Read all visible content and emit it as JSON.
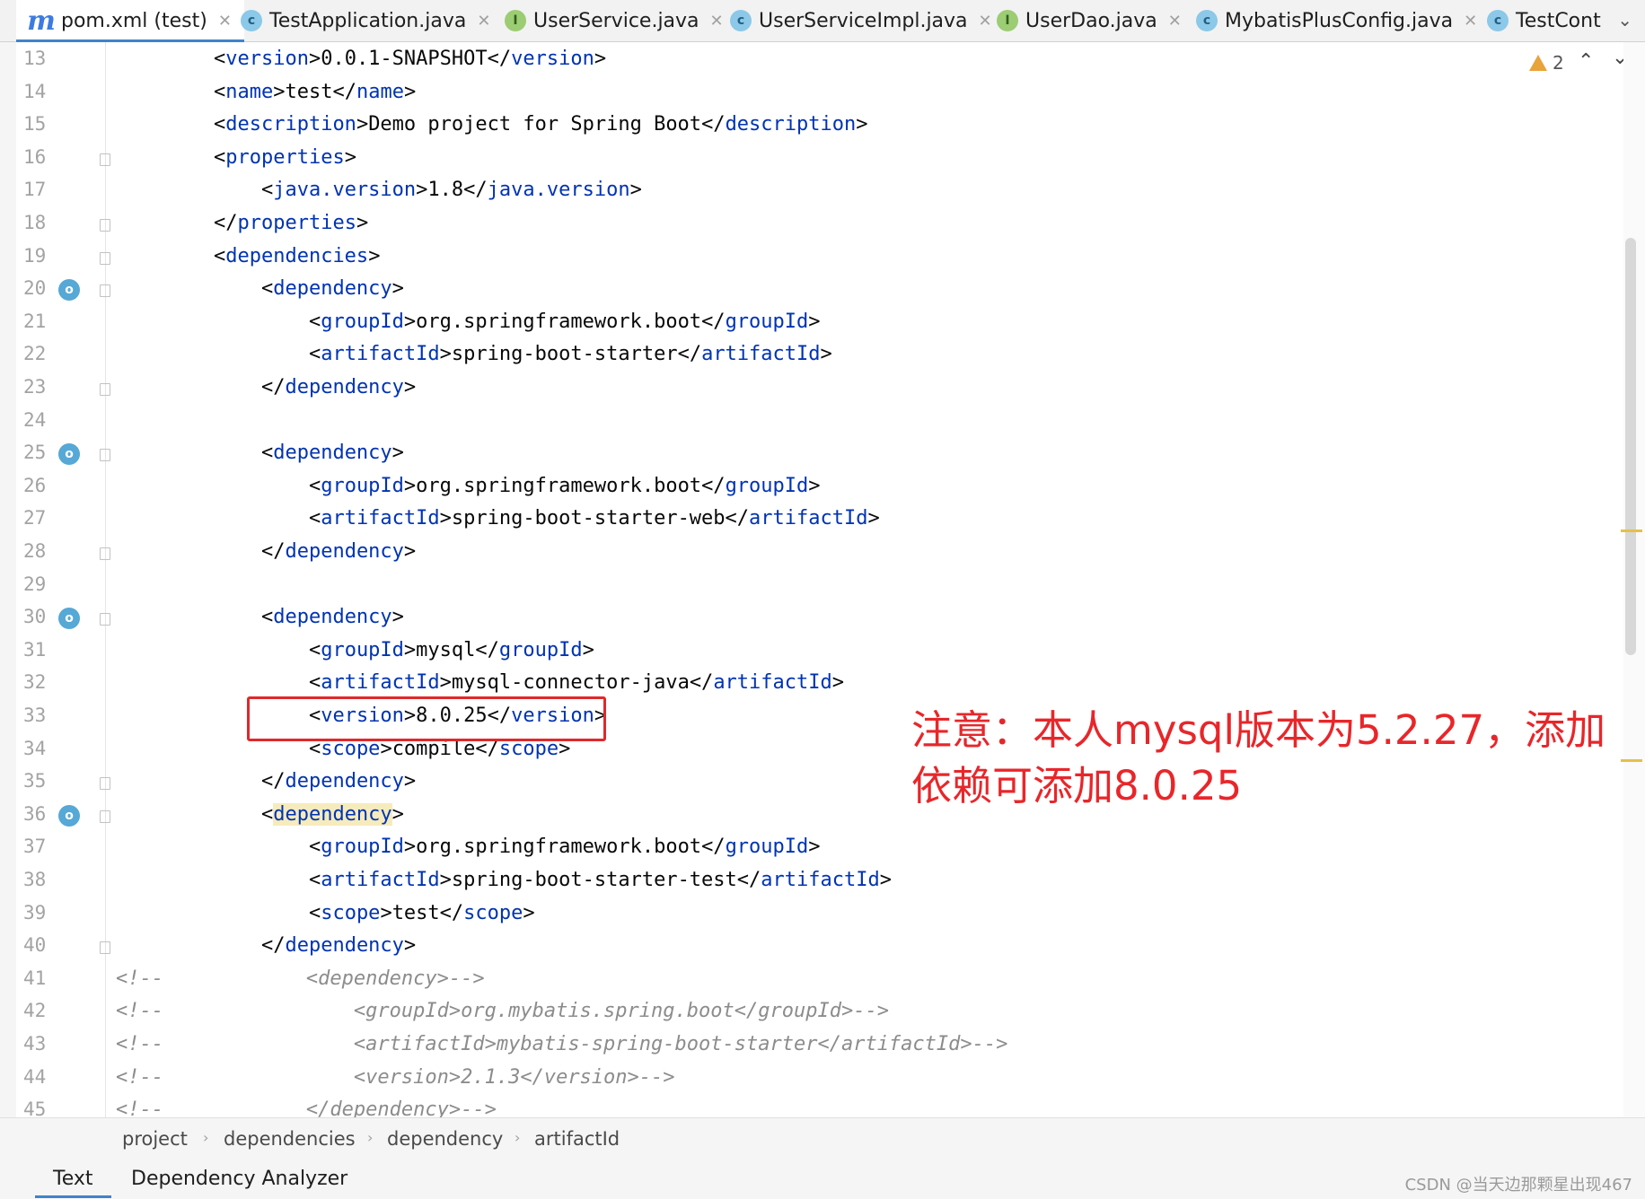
{
  "tabs": [
    {
      "label": "pom.xml (test)",
      "icon": "maven-icon",
      "active": true
    },
    {
      "label": "TestApplication.java",
      "icon": "spring-class-icon"
    },
    {
      "label": "UserService.java",
      "icon": "interface-icon"
    },
    {
      "label": "UserServiceImpl.java",
      "icon": "class-icon"
    },
    {
      "label": "UserDao.java",
      "icon": "interface-icon"
    },
    {
      "label": "MybatisPlusConfig.java",
      "icon": "class-icon"
    },
    {
      "label": "TestCont",
      "icon": "class-icon"
    }
  ],
  "inspections": {
    "warning_count": "2"
  },
  "code_lines": [
    {
      "n": "13",
      "t": "    <version>0.0.1-SNAPSHOT</version>"
    },
    {
      "n": "14",
      "t": "    <name>test</name>"
    },
    {
      "n": "15",
      "t": "    <description>Demo project for Spring Boot</description>"
    },
    {
      "n": "16",
      "t": "    <properties>"
    },
    {
      "n": "17",
      "t": "        <java.version>1.8</java.version>"
    },
    {
      "n": "18",
      "t": "    </properties>"
    },
    {
      "n": "19",
      "t": "    <dependencies>"
    },
    {
      "n": "20",
      "t": "        <dependency>"
    },
    {
      "n": "21",
      "t": "            <groupId>org.springframework.boot</groupId>"
    },
    {
      "n": "22",
      "t": "            <artifactId>spring-boot-starter</artifactId>"
    },
    {
      "n": "23",
      "t": "        </dependency>"
    },
    {
      "n": "24",
      "t": ""
    },
    {
      "n": "25",
      "t": "        <dependency>"
    },
    {
      "n": "26",
      "t": "            <groupId>org.springframework.boot</groupId>"
    },
    {
      "n": "27",
      "t": "            <artifactId>spring-boot-starter-web</artifactId>"
    },
    {
      "n": "28",
      "t": "        </dependency>"
    },
    {
      "n": "29",
      "t": ""
    },
    {
      "n": "30",
      "t": "        <dependency>"
    },
    {
      "n": "31",
      "t": "            <groupId>mysql</groupId>"
    },
    {
      "n": "32",
      "t": "            <artifactId>mysql-connector-java</artifactId>"
    },
    {
      "n": "33",
      "t": "            <version>8.0.25</version>"
    },
    {
      "n": "34",
      "t": "            <scope>compile</scope>"
    },
    {
      "n": "35",
      "t": "        </dependency>"
    },
    {
      "n": "36",
      "t": "        <dependency>"
    },
    {
      "n": "37",
      "t": "            <groupId>org.springframework.boot</groupId>"
    },
    {
      "n": "38",
      "t": "            <artifactId>spring-boot-starter-test</artifactId>"
    },
    {
      "n": "39",
      "t": "            <scope>test</scope>"
    },
    {
      "n": "40",
      "t": "        </dependency>"
    },
    {
      "n": "41",
      "t": "<!--            <dependency>-->"
    },
    {
      "n": "42",
      "t": "<!--                <groupId>org.mybatis.spring.boot</groupId>-->"
    },
    {
      "n": "43",
      "t": "<!--                <artifactId>mybatis-spring-boot-starter</artifactId>-->"
    },
    {
      "n": "44",
      "t": "<!--                <version>2.1.3</version>-->"
    },
    {
      "n": "45",
      "t": "<!--            </dependency>-->"
    }
  ],
  "annotation": {
    "line1": "注意：本人mysql版本为5.2.27，添加",
    "line2": "依赖可添加8.0.25"
  },
  "breadcrumb": [
    "project",
    "dependencies",
    "dependency",
    "artifactId"
  ],
  "bottom_tabs": [
    {
      "label": "Text",
      "active": true
    },
    {
      "label": "Dependency Analyzer"
    }
  ],
  "watermark": "CSDN @当天边那颗星出现467",
  "colors": {
    "tag": "#0033b3",
    "comment": "#8c8c8c",
    "annotation": "#e8262a",
    "accent": "#4083c9"
  }
}
